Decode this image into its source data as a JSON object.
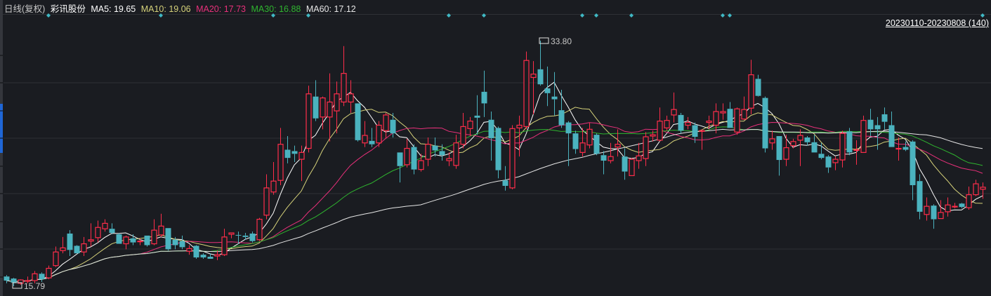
{
  "header": {
    "period": "日线(复权)",
    "stock_name": "彩讯股份",
    "ma": [
      {
        "label": "MA5: 19.65",
        "color": "#ffffff"
      },
      {
        "label": "MA10: 19.06",
        "color": "#d6d27a"
      },
      {
        "label": "MA20: 17.73",
        "color": "#e8307a"
      },
      {
        "label": "MA30: 16.88",
        "color": "#2fb52f"
      },
      {
        "label": "MA60: 17.12",
        "color": "#e6e6e6"
      }
    ]
  },
  "range_label": "20230110-20230808 (140)",
  "colors": {
    "background": "#1a1c21",
    "up": "#ff2d4a",
    "down": "#4bb3bf",
    "grid": "#2e3035",
    "marker": "#3fb8c4"
  },
  "chart_data": {
    "type": "candlestick",
    "date_range": [
      "20230110",
      "20230808"
    ],
    "count": 140,
    "ylim": [
      15.79,
      33.8
    ],
    "high_label": "33.80",
    "low_label": "15.79",
    "grid": true,
    "moving_averages": [
      5,
      10,
      20,
      30,
      60
    ],
    "event_marker_indices": [
      6,
      22,
      38,
      43,
      63,
      68,
      82,
      84,
      89,
      102,
      103,
      139
    ],
    "ohlc": [
      [
        16.5,
        16.6,
        16.0,
        16.2
      ],
      [
        16.35,
        16.4,
        15.79,
        16.05
      ],
      [
        16.0,
        16.3,
        15.9,
        16.25
      ],
      [
        16.2,
        16.5,
        16.0,
        16.2
      ],
      [
        16.2,
        16.9,
        16.0,
        16.7
      ],
      [
        16.7,
        16.8,
        16.1,
        16.3
      ],
      [
        16.4,
        17.3,
        16.3,
        17.1
      ],
      [
        17.3,
        18.7,
        17.2,
        18.3
      ],
      [
        18.4,
        19.4,
        18.2,
        18.6
      ],
      [
        19.65,
        19.9,
        18.0,
        18.45
      ],
      [
        18.75,
        18.8,
        18.2,
        18.2
      ],
      [
        18.3,
        19.4,
        18.0,
        18.9
      ],
      [
        19.1,
        20.4,
        18.7,
        19.2
      ],
      [
        19.35,
        20.6,
        19.0,
        20.1
      ],
      [
        20.0,
        20.7,
        19.8,
        20.4
      ],
      [
        20.0,
        20.4,
        19.6,
        19.7
      ],
      [
        19.6,
        19.7,
        18.9,
        18.9
      ],
      [
        18.9,
        19.5,
        18.5,
        19.4
      ],
      [
        19.3,
        19.6,
        18.8,
        19.0
      ],
      [
        19.1,
        19.3,
        18.8,
        19.1
      ],
      [
        19.5,
        19.5,
        18.7,
        18.8
      ],
      [
        18.9,
        20.7,
        18.8,
        19.9
      ],
      [
        19.55,
        21.1,
        19.4,
        20.2
      ],
      [
        20.05,
        20.05,
        18.4,
        18.5
      ],
      [
        19.2,
        19.4,
        18.5,
        18.8
      ],
      [
        19.1,
        19.5,
        18.5,
        18.65
      ],
      [
        18.35,
        18.8,
        18.1,
        18.55
      ],
      [
        18.75,
        18.8,
        17.8,
        17.9
      ],
      [
        18.1,
        18.2,
        17.8,
        17.9
      ],
      [
        17.95,
        18.2,
        17.8,
        17.8
      ],
      [
        18.0,
        18.4,
        17.7,
        18.1
      ],
      [
        18.1,
        20.0,
        18.0,
        19.4
      ],
      [
        19.6,
        19.7,
        19.3,
        19.7
      ],
      [
        19.55,
        19.8,
        18.9,
        19.5
      ],
      [
        19.5,
        19.7,
        19.2,
        19.4
      ],
      [
        19.65,
        19.8,
        19.0,
        19.1
      ],
      [
        19.2,
        20.8,
        19.1,
        20.7
      ],
      [
        21.0,
        24.0,
        20.7,
        23.0
      ],
      [
        22.7,
        24.9,
        22.5,
        23.5
      ],
      [
        23.55,
        27.4,
        23.2,
        26.2
      ],
      [
        25.8,
        26.8,
        24.8,
        25.2
      ],
      [
        25.7,
        26.1,
        24.9,
        25.5
      ],
      [
        25.1,
        26.1,
        23.5,
        25.6
      ],
      [
        25.9,
        30.5,
        25.6,
        29.9
      ],
      [
        29.7,
        30.9,
        27.9,
        28.1
      ],
      [
        28.2,
        29.7,
        27.3,
        29.6
      ],
      [
        28.2,
        31.4,
        26.4,
        29.3
      ],
      [
        28.65,
        30.8,
        27.0,
        29.9
      ],
      [
        29.3,
        33.4,
        29.0,
        31.4
      ],
      [
        29.3,
        30.9,
        28.5,
        29.9
      ],
      [
        29.2,
        29.2,
        26.4,
        26.5
      ],
      [
        26.3,
        27.9,
        26.0,
        26.85
      ],
      [
        26.45,
        27.4,
        26.0,
        26.2
      ],
      [
        26.3,
        27.9,
        26.0,
        27.6
      ],
      [
        27.2,
        28.5,
        26.6,
        28.35
      ],
      [
        28.0,
        28.5,
        26.7,
        27.0
      ],
      [
        25.6,
        25.6,
        23.4,
        24.6
      ],
      [
        24.7,
        26.6,
        24.5,
        25.9
      ],
      [
        26.0,
        26.2,
        24.0,
        24.35
      ],
      [
        24.35,
        25.5,
        24.2,
        25.0
      ],
      [
        25.1,
        26.7,
        24.6,
        26.2
      ],
      [
        26.1,
        26.7,
        25.3,
        25.75
      ],
      [
        25.7,
        26.2,
        25.0,
        25.4
      ],
      [
        25.0,
        25.6,
        24.6,
        25.15
      ],
      [
        24.65,
        26.9,
        24.4,
        26.3
      ],
      [
        26.2,
        28.5,
        25.9,
        27.5
      ],
      [
        27.35,
        28.2,
        26.8,
        27.9
      ],
      [
        28.3,
        29.8,
        26.9,
        28.15
      ],
      [
        30.05,
        31.6,
        28.2,
        29.2
      ],
      [
        28.0,
        28.6,
        25.0,
        26.65
      ],
      [
        27.4,
        27.5,
        23.7,
        24.3
      ],
      [
        23.55,
        24.6,
        22.8,
        23.15
      ],
      [
        23.0,
        27.6,
        22.9,
        27.35
      ],
      [
        27.4,
        28.3,
        25.3,
        27.6
      ],
      [
        27.5,
        33.0,
        27.3,
        32.35
      ],
      [
        31.1,
        32.3,
        28.4,
        31.35
      ],
      [
        31.7,
        33.8,
        30.5,
        30.6
      ],
      [
        30.3,
        31.9,
        29.0,
        29.95
      ],
      [
        29.7,
        31.5,
        28.3,
        29.5
      ],
      [
        28.7,
        30.2,
        27.4,
        27.6
      ],
      [
        27.8,
        27.9,
        24.6,
        27.0
      ],
      [
        27.0,
        27.2,
        25.5,
        25.85
      ],
      [
        25.6,
        27.4,
        25.3,
        26.3
      ],
      [
        26.15,
        27.8,
        25.9,
        27.3
      ],
      [
        26.9,
        27.0,
        25.4,
        25.5
      ],
      [
        25.4,
        25.7,
        24.0,
        25.0
      ],
      [
        25.0,
        26.3,
        24.8,
        25.3
      ],
      [
        26.0,
        27.3,
        25.3,
        26.2
      ],
      [
        25.3,
        25.9,
        23.6,
        24.2
      ],
      [
        23.9,
        25.2,
        23.9,
        25.1
      ],
      [
        25.0,
        26.3,
        24.4,
        25.35
      ],
      [
        25.15,
        27.1,
        24.6,
        26.75
      ],
      [
        26.8,
        27.2,
        26.4,
        26.9
      ],
      [
        26.5,
        28.9,
        26.4,
        27.9
      ],
      [
        27.4,
        28.3,
        27.2,
        27.95
      ],
      [
        28.35,
        30.0,
        27.8,
        28.75
      ],
      [
        28.35,
        28.5,
        27.0,
        27.2
      ],
      [
        27.6,
        28.2,
        27.3,
        27.8
      ],
      [
        27.6,
        27.8,
        26.3,
        26.75
      ],
      [
        27.2,
        27.3,
        25.8,
        27.2
      ],
      [
        27.8,
        28.3,
        27.3,
        27.9
      ],
      [
        27.6,
        29.2,
        27.0,
        28.6
      ],
      [
        28.5,
        29.2,
        28.0,
        28.6
      ],
      [
        28.8,
        29.3,
        27.4,
        27.4
      ],
      [
        27.1,
        28.9,
        26.9,
        28.8
      ],
      [
        28.05,
        29.7,
        28.0,
        28.75
      ],
      [
        28.85,
        32.4,
        28.4,
        31.3
      ],
      [
        31.0,
        31.3,
        29.7,
        29.75
      ],
      [
        29.6,
        29.7,
        25.6,
        25.9
      ],
      [
        26.3,
        27.2,
        25.8,
        26.6
      ],
      [
        26.8,
        26.8,
        23.9,
        25.05
      ],
      [
        25.1,
        26.9,
        24.6,
        25.95
      ],
      [
        26.1,
        26.6,
        25.9,
        26.4
      ],
      [
        26.5,
        27.3,
        24.6,
        26.85
      ],
      [
        26.7,
        26.8,
        26.1,
        26.35
      ],
      [
        26.35,
        26.9,
        25.6,
        25.6
      ],
      [
        25.5,
        26.3,
        25.1,
        25.2
      ],
      [
        25.3,
        25.4,
        24.1,
        24.5
      ],
      [
        24.85,
        25.3,
        24.3,
        25.1
      ],
      [
        25.05,
        27.2,
        24.5,
        27.0
      ],
      [
        27.15,
        27.4,
        25.4,
        25.6
      ],
      [
        25.8,
        26.5,
        24.7,
        25.8
      ],
      [
        25.6,
        28.3,
        25.6,
        27.95
      ],
      [
        28.0,
        28.8,
        26.8,
        27.3
      ],
      [
        27.6,
        28.2,
        25.8,
        27.3
      ],
      [
        28.4,
        28.9,
        27.3,
        27.85
      ],
      [
        27.6,
        28.6,
        26.0,
        26.0
      ],
      [
        25.9,
        26.7,
        25.0,
        25.9
      ],
      [
        26.0,
        26.4,
        25.7,
        25.8
      ],
      [
        26.4,
        26.5,
        22.1,
        23.2
      ],
      [
        23.5,
        24.0,
        20.7,
        21.25
      ],
      [
        21.05,
        22.3,
        20.6,
        21.65
      ],
      [
        21.7,
        21.8,
        20.0,
        20.7
      ],
      [
        20.75,
        22.1,
        20.75,
        21.2
      ],
      [
        21.25,
        22.3,
        20.9,
        21.75
      ],
      [
        21.65,
        21.9,
        21.5,
        21.65
      ],
      [
        21.85,
        21.9,
        21.5,
        21.6
      ],
      [
        21.55,
        23.1,
        21.4,
        22.5
      ],
      [
        22.5,
        23.6,
        22.4,
        23.3
      ],
      [
        22.9,
        23.4,
        22.2,
        23.05
      ]
    ]
  }
}
